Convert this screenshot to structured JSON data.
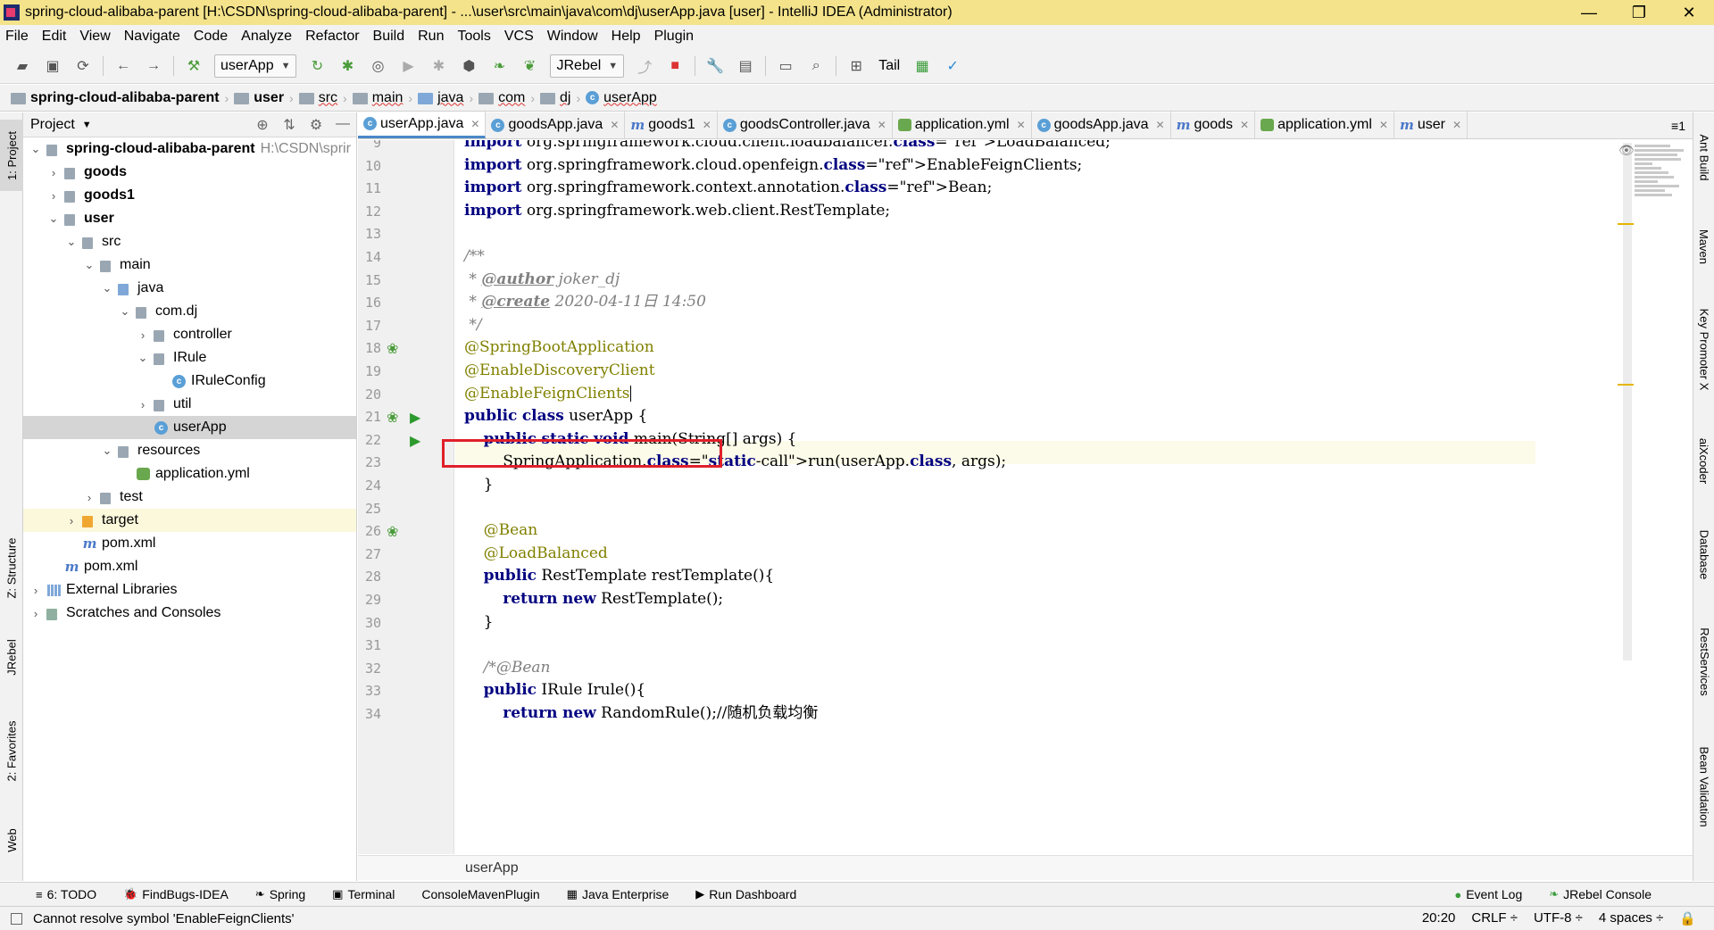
{
  "window": {
    "title": "spring-cloud-alibaba-parent [H:\\CSDN\\spring-cloud-alibaba-parent] - ...\\user\\src\\main\\java\\com\\dj\\userApp.java [user] - IntelliJ IDEA (Administrator)",
    "controls": [
      "—",
      "❐",
      "✕"
    ]
  },
  "menu": [
    "File",
    "Edit",
    "View",
    "Navigate",
    "Code",
    "Analyze",
    "Refactor",
    "Build",
    "Run",
    "Tools",
    "VCS",
    "Window",
    "Help",
    "Plugin"
  ],
  "toolbar": {
    "run_config": "userApp",
    "jrebel": "JRebel",
    "tail": "Tail"
  },
  "breadcrumbs": [
    "spring-cloud-alibaba-parent",
    "user",
    "src",
    "main",
    "java",
    "com",
    "dj",
    "userApp"
  ],
  "project": {
    "header": "Project",
    "tree": [
      {
        "label": "spring-cloud-alibaba-parent",
        "extra": "H:\\CSDN\\sprir",
        "depth": 0,
        "toggle": "⌄",
        "icon": "folder",
        "bold": true
      },
      {
        "label": "goods",
        "depth": 1,
        "toggle": "›",
        "icon": "folder",
        "bold": true
      },
      {
        "label": "goods1",
        "depth": 1,
        "toggle": "›",
        "icon": "folder",
        "bold": true
      },
      {
        "label": "user",
        "depth": 1,
        "toggle": "⌄",
        "icon": "folder",
        "bold": true
      },
      {
        "label": "src",
        "depth": 2,
        "toggle": "⌄",
        "icon": "folder"
      },
      {
        "label": "main",
        "depth": 3,
        "toggle": "⌄",
        "icon": "folder"
      },
      {
        "label": "java",
        "depth": 4,
        "toggle": "⌄",
        "icon": "folder-blue"
      },
      {
        "label": "com.dj",
        "depth": 5,
        "toggle": "⌄",
        "icon": "folder"
      },
      {
        "label": "controller",
        "depth": 6,
        "toggle": "›",
        "icon": "folder"
      },
      {
        "label": "IRule",
        "depth": 6,
        "toggle": "⌄",
        "icon": "folder"
      },
      {
        "label": "IRuleConfig",
        "depth": 7,
        "toggle": "",
        "icon": "class"
      },
      {
        "label": "util",
        "depth": 6,
        "toggle": "›",
        "icon": "folder"
      },
      {
        "label": "userApp",
        "depth": 6,
        "toggle": "",
        "icon": "class",
        "selected": true
      },
      {
        "label": "resources",
        "depth": 4,
        "toggle": "⌄",
        "icon": "folder"
      },
      {
        "label": "application.yml",
        "depth": 5,
        "toggle": "",
        "icon": "yml"
      },
      {
        "label": "test",
        "depth": 3,
        "toggle": "›",
        "icon": "folder"
      },
      {
        "label": "target",
        "depth": 2,
        "toggle": "›",
        "icon": "folder-orange",
        "highlighted": true
      },
      {
        "label": "pom.xml",
        "depth": 2,
        "toggle": "",
        "icon": "maven"
      },
      {
        "label": "pom.xml",
        "depth": 1,
        "toggle": "",
        "icon": "maven"
      },
      {
        "label": "External Libraries",
        "depth": 0,
        "toggle": "›",
        "icon": "libs"
      },
      {
        "label": "Scratches and Consoles",
        "depth": 0,
        "toggle": "›",
        "icon": "scratch"
      }
    ]
  },
  "left_tabs": [
    "1: Project",
    "Z: Structure",
    "JRebel",
    "2: Favorites",
    "Web"
  ],
  "right_tabs": [
    "Ant Build",
    "Maven",
    "Key Promoter X",
    "aiXcoder",
    "Database",
    "RestServices",
    "Bean Validation"
  ],
  "editor_tabs": [
    {
      "label": "userApp.java",
      "icon": "class",
      "active": true
    },
    {
      "label": "goodsApp.java",
      "icon": "class"
    },
    {
      "label": "goods1",
      "icon": "maven"
    },
    {
      "label": "goodsController.java",
      "icon": "class"
    },
    {
      "label": "application.yml",
      "icon": "yml"
    },
    {
      "label": "goodsApp.java",
      "icon": "class"
    },
    {
      "label": "goods",
      "icon": "maven"
    },
    {
      "label": "application.yml",
      "icon": "yml"
    },
    {
      "label": "user",
      "icon": "maven"
    }
  ],
  "tabs_more": "≡1",
  "code": {
    "first_line": 9,
    "lines": [
      "import org.springframework.cloud.client.loadbalancer.LoadBalanced;",
      "import org.springframework.cloud.openfeign.EnableFeignClients;",
      "import org.springframework.context.annotation.Bean;",
      "import org.springframework.web.client.RestTemplate;",
      "",
      "/**",
      " * @author joker_dj",
      " * @create 2020-04-11日 14:50",
      " */",
      "@SpringBootApplication",
      "@EnableDiscoveryClient",
      "@EnableFeignClients",
      "public class userApp {",
      "    public static void main(String[] args) {",
      "        SpringApplication.run(userApp.class, args);",
      "    }",
      "",
      "    @Bean",
      "    @LoadBalanced",
      "    public RestTemplate restTemplate(){",
      "        return new RestTemplate();",
      "    }",
      "",
      "    /*@Bean",
      "    public IRule Irule(){",
      "        return new RandomRule();//随机负载均衡"
    ]
  },
  "code_breadcrumb": "userApp",
  "bottom_tools": [
    {
      "label": "6: TODO",
      "icon": "≡"
    },
    {
      "label": "FindBugs-IDEA",
      "icon": "🐞"
    },
    {
      "label": "Spring",
      "icon": "❧"
    },
    {
      "label": "Terminal",
      "icon": "▣"
    },
    {
      "label": "ConsoleMavenPlugin",
      "icon": ""
    },
    {
      "label": "Java Enterprise",
      "icon": "▦"
    },
    {
      "label": "Run Dashboard",
      "icon": "▶"
    }
  ],
  "bottom_tools_right": [
    {
      "label": "Event Log",
      "icon": "●"
    },
    {
      "label": "JRebel Console",
      "icon": "❧"
    }
  ],
  "status": {
    "message": "Cannot resolve symbol 'EnableFeignClients'",
    "position": "20:20",
    "line_sep": "CRLF ÷",
    "encoding": "UTF-8 ÷",
    "indent": "4 spaces ÷"
  },
  "colors": {
    "title_bar": "#f4e38b",
    "error_box": "#e0202a",
    "keyword": "#000080",
    "annotation": "#808000"
  }
}
